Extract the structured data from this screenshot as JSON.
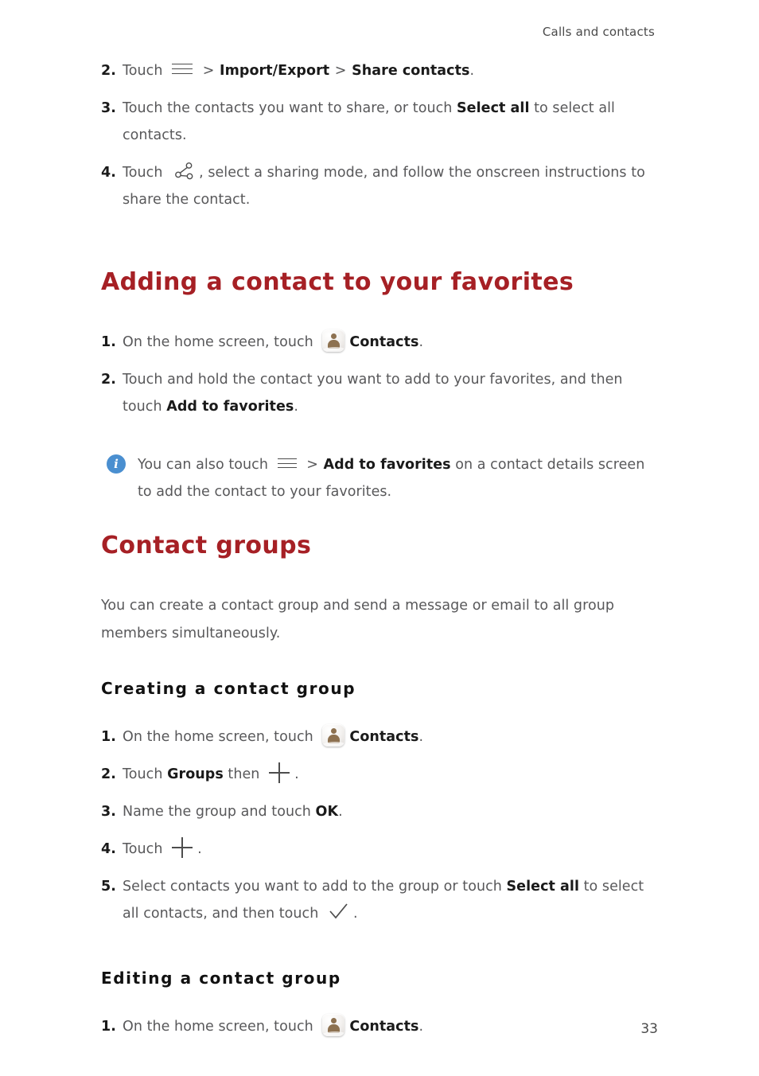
{
  "header": {
    "running_head": "Calls and contacts"
  },
  "footer": {
    "page_number": "33"
  },
  "colors": {
    "heading_red": "#a62025",
    "body_gray": "#58585a",
    "bold_black": "#1a1a1a",
    "info_blue": "#4a8fd0",
    "contacts_icon_person": "#8d7150"
  },
  "icons": {
    "menu": "menu-icon",
    "share": "share-icon",
    "plus": "plus-icon",
    "check": "check-icon",
    "contacts_app": "contacts-app-icon",
    "info": "info-icon"
  },
  "section_share": {
    "steps": [
      {
        "num": "2.",
        "part1": "Touch ",
        "part2": " > ",
        "bold1": "Import/Export",
        "part3": " > ",
        "bold2": "Share contacts",
        "part4": "."
      },
      {
        "num": "3.",
        "part1": "Touch the contacts you want to share, or touch ",
        "bold1": "Select all",
        "part2": " to select all contacts."
      },
      {
        "num": "4.",
        "part1": "Touch ",
        "part2": ", select a sharing mode, and follow the onscreen instructions to share the contact."
      }
    ]
  },
  "section_favorites": {
    "heading": "Adding a contact to your favorites",
    "steps": [
      {
        "num": "1.",
        "part1": "On the home screen, touch ",
        "bold1": "Contacts",
        "part2": "."
      },
      {
        "num": "2.",
        "part1": "Touch and hold the contact you want to add to your favorites, and then touch ",
        "bold1": "Add to favorites",
        "part2": "."
      }
    ],
    "note": {
      "part1": "You can also touch ",
      "part2": " > ",
      "bold1": "Add to favorites",
      "part3": " on a contact details screen to add the contact to your favorites."
    }
  },
  "section_groups": {
    "heading": "Contact groups",
    "intro": "You can create a contact group and send a message or email to all group members simultaneously.",
    "creating": {
      "heading": "Creating a contact group",
      "steps": [
        {
          "num": "1.",
          "part1": "On the home screen, touch ",
          "bold1": "Contacts",
          "part2": "."
        },
        {
          "num": "2.",
          "part1": "Touch ",
          "bold1": "Groups",
          "part2": " then ",
          "part3": "."
        },
        {
          "num": "3.",
          "part1": "Name the group and touch ",
          "bold1": "OK",
          "part2": "."
        },
        {
          "num": "4.",
          "part1": "Touch ",
          "part2": "."
        },
        {
          "num": "5.",
          "part1": "Select contacts you want to add to the group or touch ",
          "bold1": "Select all",
          "part2": " to select all contacts, and then touch ",
          "part3": "."
        }
      ]
    },
    "editing": {
      "heading": "Editing a contact group",
      "steps": [
        {
          "num": "1.",
          "part1": "On the home screen, touch ",
          "bold1": "Contacts",
          "part2": "."
        }
      ]
    }
  }
}
